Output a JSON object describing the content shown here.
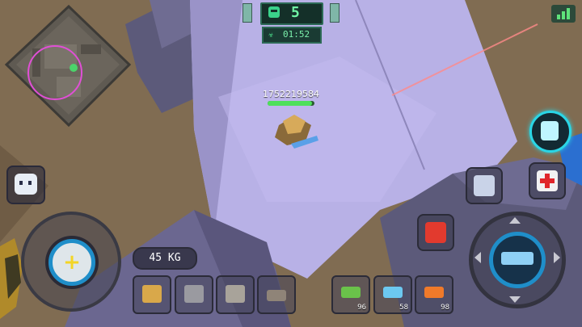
{
  "hud": {
    "players_alive": "5",
    "timer": "01:52",
    "timer_icon": "biohazard-icon",
    "alive_icon": "skull-icon"
  },
  "player": {
    "name": "1752219584",
    "health_fraction": 0.95
  },
  "signal": {
    "bars": 3,
    "color": "#5ee27a"
  },
  "inventory": {
    "weight": "45 KG",
    "equipment_slots": [
      {
        "icon": "helmet-icon",
        "color": "#d9a84a"
      },
      {
        "icon": "armor-vest-icon",
        "color": "#9a9aa0"
      },
      {
        "icon": "backpack-icon",
        "color": "#a8a39a"
      },
      {
        "icon": "boots-icon",
        "color": "#8f8478"
      }
    ],
    "weapon_slots": [
      {
        "icon": "green-gun-icon",
        "count": "96",
        "color": "#6ac24a"
      },
      {
        "icon": "blue-gun-icon",
        "count": "58",
        "color": "#6cc8f0"
      },
      {
        "icon": "orange-gun-icon",
        "count": "98",
        "color": "#f07a2a"
      }
    ]
  },
  "buttons": {
    "emote": "emote-face-icon",
    "backpack": "backpack-icon",
    "robot": "robot-icon",
    "medkit": "medkit-icon",
    "grenade": "red-canister-icon",
    "fire": "blue-blaster-icon"
  }
}
